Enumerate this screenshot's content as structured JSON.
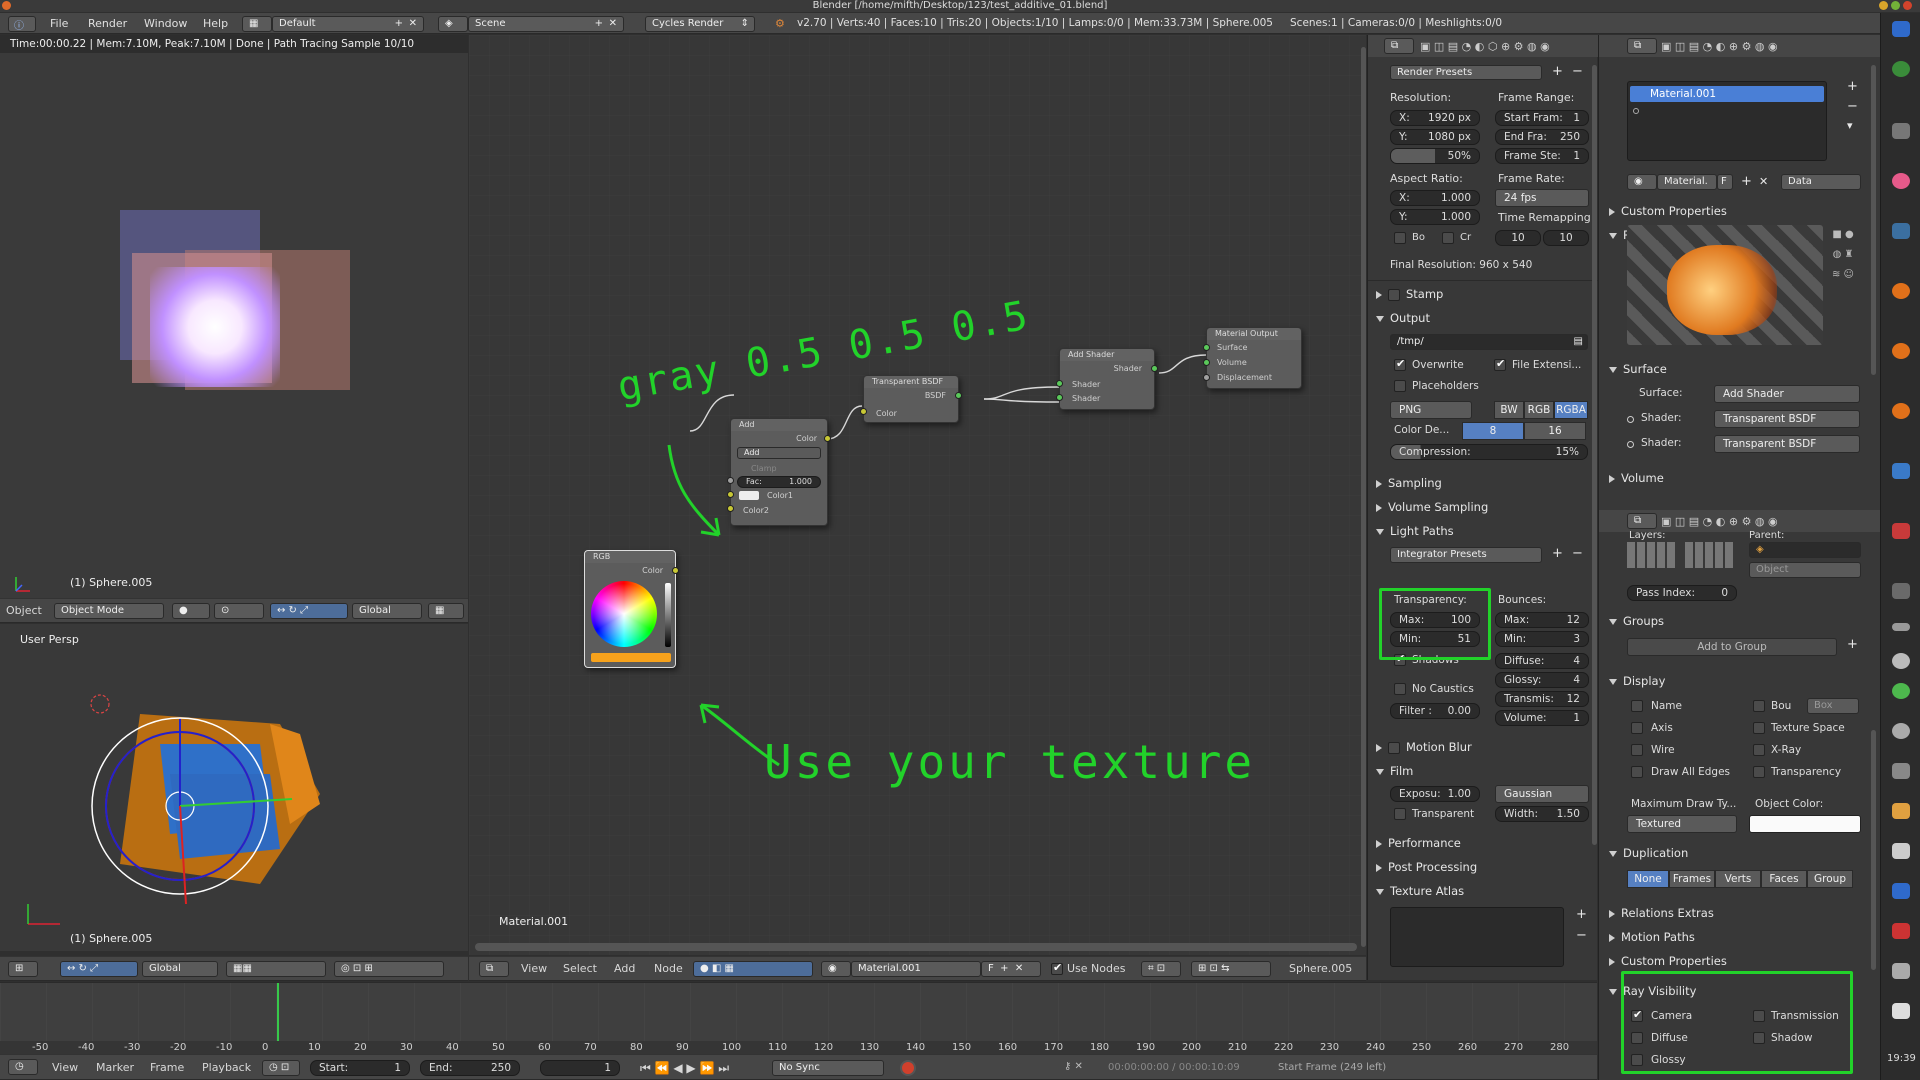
{
  "titlebar": {
    "title": "Blender [/home/mifth/Desktop/123/test_additive_01.blend]"
  },
  "menubar": {
    "menus": [
      "File",
      "Render",
      "Window",
      "Help"
    ],
    "layout": "Default",
    "scene": "Scene",
    "engine": "Cycles Render",
    "stats": "v2.70 | Verts:40 | Faces:10 | Tris:20 | Objects:1/10 | Lamps:0/0 | Mem:33.73M | Sphere.005",
    "scenes": "Scenes:1 | Cameras:0/0 | Meshlights:0/0"
  },
  "render_view": {
    "status": "Time:00:00.22 | Mem:7.10M, Peak:7.10M | Done | Path Tracing Sample 10/10",
    "object_label": "(1) Sphere.005",
    "header": {
      "object": "Object",
      "mode": "Object Mode",
      "orientation": "Global"
    }
  },
  "view3d": {
    "title": "User Persp",
    "object_label": "(1) Sphere.005",
    "orientation": "Global"
  },
  "node_editor": {
    "material_label": "Material.001",
    "annotation_gray": "gray 0.5 0.5 0.5",
    "annotation_texture": "Use your texture",
    "header": {
      "menus": [
        "View",
        "Select",
        "Add",
        "Node"
      ],
      "material": "Material.001",
      "use_nodes": "Use Nodes",
      "object": "Sphere.005"
    },
    "nodes": {
      "add": {
        "title": "Add",
        "out": "Color",
        "blend": "Add",
        "clamp": "Clamp",
        "fac_label": "Fac:",
        "fac": "1.000",
        "in1": "Color1",
        "in2": "Color2"
      },
      "rgb": {
        "title": "RGB",
        "out": "Color"
      },
      "transparent": {
        "title": "Transparent BSDF",
        "out": "BSDF",
        "in": "Color"
      },
      "add_shader": {
        "title": "Add Shader",
        "out": "Shader",
        "in1": "Shader",
        "in2": "Shader"
      },
      "output": {
        "title": "Material Output",
        "in1": "Surface",
        "in2": "Volume",
        "in3": "Displacement"
      }
    }
  },
  "render_props": {
    "presets": "Render Presets",
    "resolution_label": "Resolution:",
    "res_x": {
      "label": "X:",
      "value": "1920 px"
    },
    "res_y": {
      "label": "Y:",
      "value": "1080 px"
    },
    "res_pct": "50%",
    "frame_range_label": "Frame Range:",
    "start_frame": {
      "label": "Start Fram:",
      "value": "1"
    },
    "end_frame": {
      "label": "End Fra:",
      "value": "250"
    },
    "frame_step": {
      "label": "Frame Ste:",
      "value": "1"
    },
    "aspect_label": "Aspect Ratio:",
    "asp_x": {
      "label": "X:",
      "value": "1.000"
    },
    "asp_y": {
      "label": "Y:",
      "value": "1.000"
    },
    "frame_rate_label": "Frame Rate:",
    "fps": "24 fps",
    "time_remap_label": "Time Remapping:",
    "remap_old": "10",
    "remap_new": "10",
    "border": "Bo",
    "crop": "Cr",
    "final_res": "Final Resolution: 960 x 540",
    "stamp": "Stamp",
    "output": "Output",
    "output_path": "/tmp/",
    "overwrite": "Overwrite",
    "file_ext": "File Extensi...",
    "placeholders": "Placeholders",
    "format": "PNG",
    "bw": "BW",
    "rgb": "RGB",
    "rgba": "RGBA",
    "color_depth_label": "Color De...",
    "depth8": "8",
    "depth16": "16",
    "compression": {
      "label": "Compression:",
      "value": "15%"
    },
    "sampling": "Sampling",
    "volume_sampling": "Volume Sampling",
    "light_paths": "Light Paths",
    "integrator": "Integrator Presets",
    "transparency_label": "Transparency:",
    "trans_max": {
      "label": "Max:",
      "value": "100"
    },
    "trans_min": {
      "label": "Min:",
      "value": "51"
    },
    "shadows": "Shadows",
    "no_caustics": "No Caustics",
    "filter": {
      "label": "Filter :",
      "value": "0.00"
    },
    "bounces_label": "Bounces:",
    "b_max": {
      "label": "Max:",
      "value": "12"
    },
    "b_min": {
      "label": "Min:",
      "value": "3"
    },
    "diffuse": {
      "label": "Diffuse:",
      "value": "4"
    },
    "glossy": {
      "label": "Glossy:",
      "value": "4"
    },
    "transmis": {
      "label": "Transmis:",
      "value": "12"
    },
    "volume": {
      "label": "Volume:",
      "value": "1"
    },
    "motion_blur": "Motion Blur",
    "film": "Film",
    "exposure": {
      "label": "Exposu:",
      "value": "1.00"
    },
    "gaussian": "Gaussian",
    "transparent": "Transparent",
    "width": {
      "label": "Width:",
      "value": "1.50"
    },
    "performance": "Performance",
    "post_processing": "Post Processing",
    "texture_atlas": "Texture Atlas"
  },
  "material_props": {
    "slot": "Material.001",
    "mat_name": "Material.",
    "fake": "F",
    "link": "Data",
    "custom_props": "Custom Properties",
    "preview": "Preview",
    "surface": "Surface",
    "surface_label": "Surface:",
    "surface_value": "Add Shader",
    "shader_label": "Shader:",
    "shader1": "Transparent BSDF",
    "shader2": "Transparent BSDF",
    "volume": "Volume"
  },
  "object_props": {
    "layers": "Layers:",
    "parent": "Parent:",
    "parent_type": "Object",
    "pass_index": {
      "label": "Pass Index:",
      "value": "0"
    },
    "groups": "Groups",
    "add_to_group": "Add to Group",
    "display": "Display",
    "name": "Name",
    "bou": "Bou",
    "box": "Box",
    "axis": "Axis",
    "texture_space": "Texture Space",
    "wire": "Wire",
    "xray": "X-Ray",
    "draw_all_edges": "Draw All Edges",
    "transparency": "Transparency",
    "max_draw_type": "Maximum Draw Ty...",
    "object_color": "Object Color:",
    "textured": "Textured",
    "duplication": "Duplication",
    "dup_none": "None",
    "dup_frames": "Frames",
    "dup_verts": "Verts",
    "dup_faces": "Faces",
    "dup_group": "Group",
    "relations_extras": "Relations Extras",
    "motion_paths": "Motion Paths",
    "custom_props": "Custom Properties",
    "ray_visibility": "Ray Visibility",
    "camera": "Camera",
    "transmission": "Transmission",
    "diffuse": "Diffuse",
    "shadow": "Shadow",
    "glossy": "Glossy"
  },
  "timeline": {
    "ticks": [
      "-50",
      "-40",
      "-30",
      "-20",
      "-10",
      "0",
      "10",
      "20",
      "30",
      "40",
      "50",
      "60",
      "70",
      "80",
      "90",
      "100",
      "110",
      "120",
      "130",
      "140",
      "150",
      "160",
      "170",
      "180",
      "190",
      "200",
      "210",
      "220",
      "230",
      "240",
      "250",
      "260",
      "270",
      "280"
    ],
    "menus": [
      "View",
      "Marker",
      "Frame",
      "Playback"
    ],
    "start": {
      "label": "Start:",
      "value": "1"
    },
    "end": {
      "label": "End:",
      "value": "250"
    },
    "current": "1",
    "sync": "No Sync",
    "timecode": "00:00:00:00 / 00:00:10:09",
    "status": "Start Frame (249 left)"
  },
  "clock": "19:39",
  "colors": {
    "annotation": "#22d22a",
    "selection_blue": "#5680c2",
    "active_material": "#4a7fd6"
  }
}
